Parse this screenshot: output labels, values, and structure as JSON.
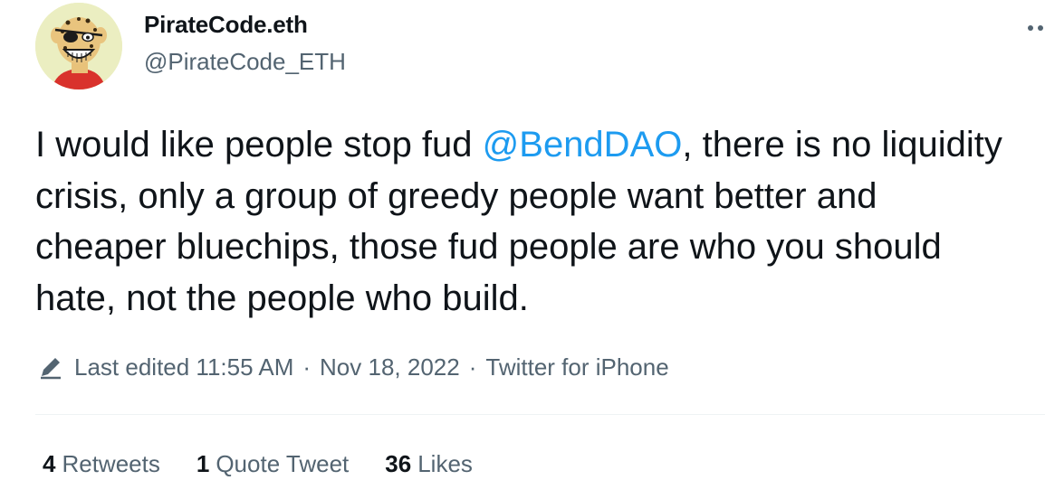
{
  "author": {
    "display_name": "PirateCode.eth",
    "handle": "@PirateCode_ETH",
    "avatar_icon": "cartoon-leopard-avatar"
  },
  "tweet": {
    "text_before": "I would like people stop fud ",
    "mention": "@BendDAO",
    "text_after": ", there is no liquidity crisis, only a group of greedy people want better and cheaper bluechips, those fud people are who you should hate, not the people who build."
  },
  "meta": {
    "edit_icon": "pencil-icon",
    "edited_label": "Last edited 11:55 AM",
    "separator": "·",
    "date": "Nov 18, 2022",
    "source": "Twitter for iPhone"
  },
  "stats": {
    "retweets_count": "4",
    "retweets_label": "Retweets",
    "quotes_count": "1",
    "quotes_label": "Quote Tweet",
    "likes_count": "36",
    "likes_label": "Likes"
  },
  "colors": {
    "link": "#1d9bf0",
    "secondary_text": "#536471",
    "primary_text": "#0f1419",
    "avatar_bg": "#ebeec1"
  }
}
